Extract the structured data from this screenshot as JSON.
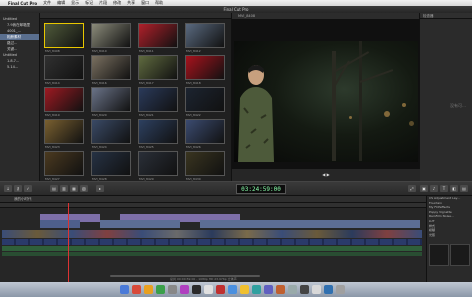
{
  "menubar": {
    "app_name": "Final Cut Pro",
    "items": [
      "文件",
      "编辑",
      "显示",
      "标记",
      "片段",
      "修改",
      "共享",
      "窗口",
      "帮助"
    ],
    "clock": ""
  },
  "window": {
    "title": "Final Cut Pro"
  },
  "sidebar": {
    "items": [
      {
        "label": "Untitled",
        "level": 1,
        "selected": false
      },
      {
        "label": "7.9我在邮箱里",
        "level": 2,
        "selected": false
      },
      {
        "label": "4001_...",
        "level": 2,
        "selected": false
      },
      {
        "label": "相册素材",
        "level": 2,
        "selected": true
      },
      {
        "label": "路过...",
        "level": 2,
        "selected": false
      },
      {
        "label": "关键...",
        "level": 2,
        "selected": false
      },
      {
        "label": "Untitled",
        "level": 1,
        "selected": false
      },
      {
        "label": "1.8.7...",
        "level": 2,
        "selected": false
      },
      {
        "label": "5.14...",
        "level": 2,
        "selected": false
      }
    ]
  },
  "browser": {
    "clips": [
      {
        "name": "MVI_8408",
        "color": "#4f5a3a",
        "selected": true
      },
      {
        "name": "MVI_8410",
        "color": "#8b8b7a",
        "selected": false
      },
      {
        "name": "MVI_8411",
        "color": "#b0202a",
        "selected": false
      },
      {
        "name": "MVI_8412",
        "color": "#5a6a80",
        "selected": false
      },
      {
        "name": "MVI_8414",
        "color": "#303030",
        "selected": false
      },
      {
        "name": "MVI_8416",
        "color": "#7a7060",
        "selected": false
      },
      {
        "name": "MVI_8417",
        "color": "#5f6a3f",
        "selected": false
      },
      {
        "name": "MVI_8418",
        "color": "#a8121d",
        "selected": false
      },
      {
        "name": "MVI_8419",
        "color": "#9e1a22",
        "selected": false
      },
      {
        "name": "MVI_8420",
        "color": "#6a7388",
        "selected": false
      },
      {
        "name": "MVI_8421",
        "color": "#2a3a5a",
        "selected": false
      },
      {
        "name": "MVI_8422",
        "color": "#1c2430",
        "selected": false
      },
      {
        "name": "MVI_8423",
        "color": "#7a6030",
        "selected": false
      },
      {
        "name": "MVI_8424",
        "color": "#3a4a66",
        "selected": false
      },
      {
        "name": "MVI_8425",
        "color": "#2d4060",
        "selected": false
      },
      {
        "name": "MVI_8426",
        "color": "#3b4b70",
        "selected": false
      },
      {
        "name": "MVI_8427",
        "color": "#4b3a20",
        "selected": false
      },
      {
        "name": "MVI_8428",
        "color": "#263244",
        "selected": false
      },
      {
        "name": "MVI_8429",
        "color": "#2a2f38",
        "selected": false
      },
      {
        "name": "MVI_8430",
        "color": "#3a3520",
        "selected": false
      }
    ]
  },
  "viewer": {
    "clip_name": "MVI_8408"
  },
  "inspector": {
    "title": "检查器",
    "empty_text": "没有可…"
  },
  "toolbar": {
    "timecode": "03:24:59:00"
  },
  "timeline": {
    "project_name": "我的小时代",
    "status": "总共 00:00:59:00 - 1080p HD 23.976p 立体声"
  },
  "effects": {
    "items": [
      "CS Adjustment Lay…",
      "Fountain",
      "My FCPeffects",
      "Poppy Vignette",
      "RainFilm Noise…",
      "LUT",
      "样式",
      "模糊",
      "光照",
      "外观",
      "失真"
    ]
  },
  "colors": {
    "accent": "#e8c700",
    "selection": "#5a6f8f",
    "playhead": "#dd3333"
  }
}
